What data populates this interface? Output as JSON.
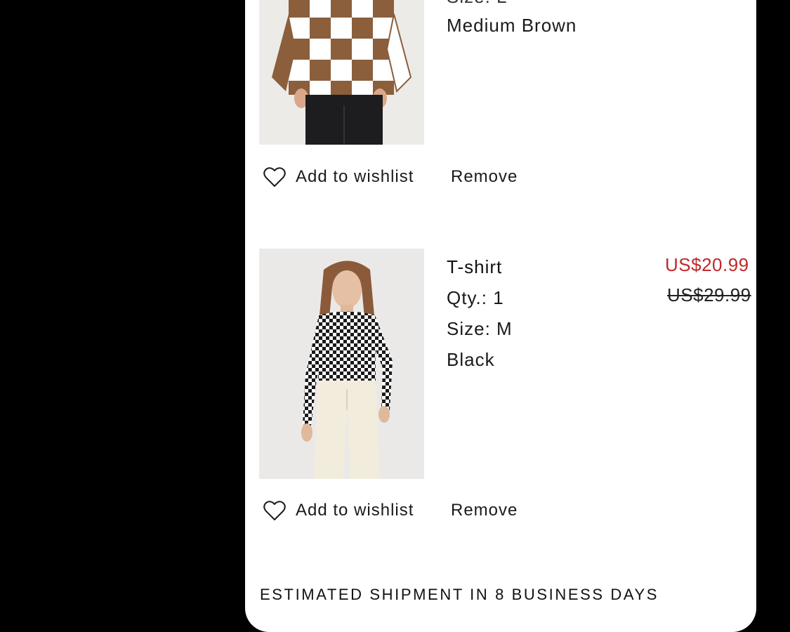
{
  "cart": {
    "items": [
      {
        "image": "checkered-brown-sweater-photo",
        "size_partial": "Size: L",
        "color": "Medium Brown",
        "wishlist_label": "Add to wishlist",
        "remove_label": "Remove"
      },
      {
        "image": "checkered-black-tshirt-photo",
        "name": "T-shirt",
        "qty": "Qty.: 1",
        "size": "Size: M",
        "color": "Black",
        "sale_price": "US$20.99",
        "original_price": "US$29.99",
        "wishlist_label": "Add to wishlist",
        "remove_label": "Remove"
      }
    ],
    "shipment_notice": "ESTIMATED SHIPMENT IN 8 BUSINESS DAYS"
  },
  "icons": {
    "wishlist": "heart-outline-icon"
  },
  "colors": {
    "sale_price": "#c0282a",
    "panel_bg": "#ffffff",
    "screen_bg": "#000000"
  }
}
